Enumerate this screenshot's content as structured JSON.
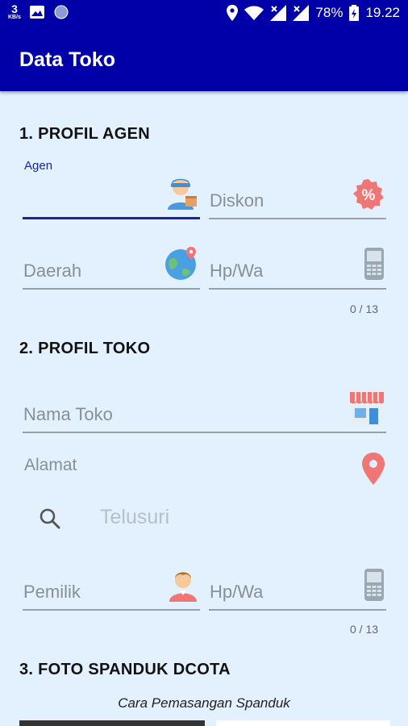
{
  "status_bar": {
    "net_speed_value": "3",
    "net_speed_unit": "KB/s",
    "battery_percent": "78%",
    "time": "19.22"
  },
  "app_bar": {
    "title": "Data Toko"
  },
  "section1": {
    "title": "1. PROFIL AGEN",
    "agen_label": "Agen",
    "diskon_placeholder": "Diskon",
    "daerah_placeholder": "Daerah",
    "hpwa_placeholder": "Hp/Wa",
    "hpwa_counter": "0 / 13"
  },
  "section2": {
    "title": "2. PROFIL TOKO",
    "nama_toko_placeholder": "Nama Toko",
    "alamat_label": "Alamat",
    "search_placeholder": "Telusuri",
    "pemilik_placeholder": "Pemilik",
    "hpwa_placeholder": "Hp/Wa",
    "hpwa_counter": "0 / 13"
  },
  "section3": {
    "title": "3. FOTO SPANDUK DCOTA",
    "caption": "Cara Pemasangan Spanduk"
  },
  "colors": {
    "primary": "#0000a8",
    "background": "#e3f0fd",
    "accent_underline": "#1a23a0",
    "icon_red": "#f07575"
  }
}
